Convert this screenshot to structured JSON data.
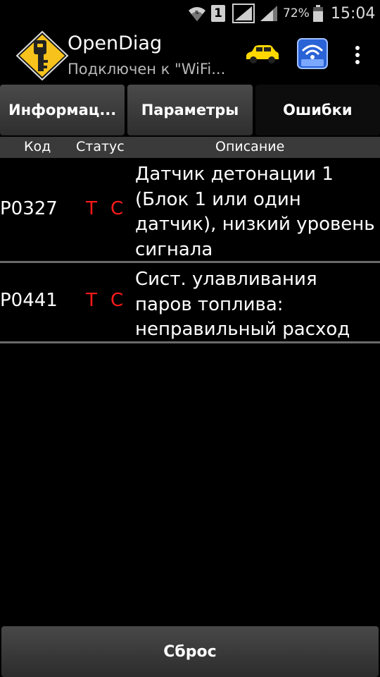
{
  "status_bar": {
    "sim_slot": "1",
    "battery_percent": "72%",
    "time": "15:04",
    "battery_level": 0.72
  },
  "action_bar": {
    "title": "OpenDiag",
    "subtitle": "Подключен к \"WiFi...",
    "icons": [
      "opendiag-key-logo-icon",
      "yellow-car-icon",
      "wifi-adapter-icon",
      "overflow-menu-icon"
    ]
  },
  "tabs": [
    {
      "label": "Информац...",
      "active": false
    },
    {
      "label": "Параметры",
      "active": false
    },
    {
      "label": "Ошибки",
      "active": true
    }
  ],
  "table": {
    "headers": {
      "code": "Код",
      "status": "Статус",
      "description": "Описание"
    },
    "rows": [
      {
        "code": "P0327",
        "status_t": "T",
        "status_c": "C",
        "description": "Датчик детонации 1 (Блок 1 или один датчик), низкий уровень сигнала"
      },
      {
        "code": "P0441",
        "status_t": "T",
        "status_c": "C",
        "description": "Сист. улавливания паров топлива: неправильный расход"
      }
    ]
  },
  "footer": {
    "reset_label": "Сброс"
  },
  "colors": {
    "background": "#000000",
    "status_red": "#ff1a1a",
    "header_bg": "#3a3a3a",
    "car_yellow": "#ffd800",
    "logo_yellow": "#f7c21b",
    "adapter_blue": "#2a63d6"
  }
}
